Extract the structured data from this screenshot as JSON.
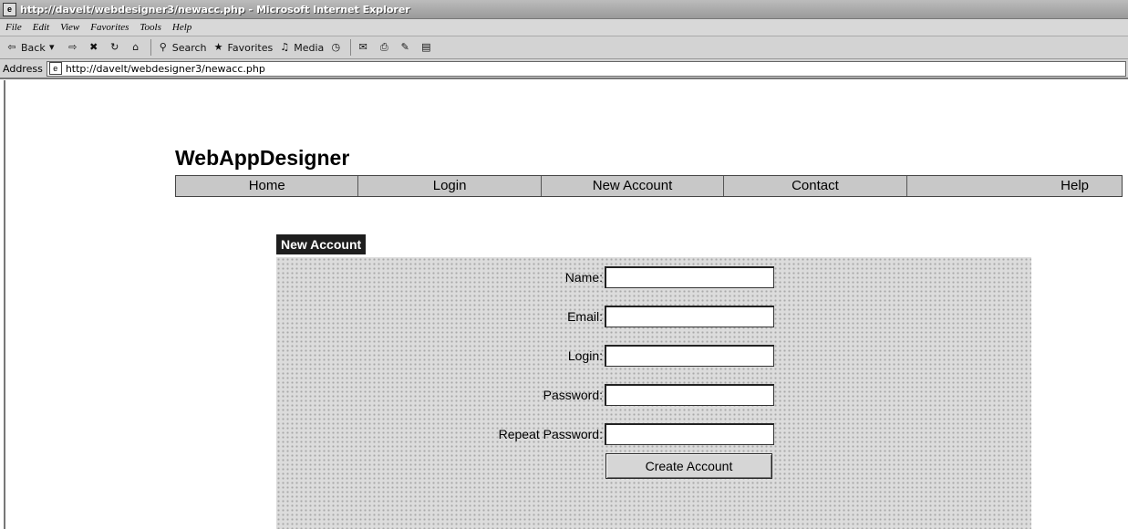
{
  "window": {
    "title": "http://davelt/webdesigner3/newacc.php - Microsoft Internet Explorer"
  },
  "menu": [
    "File",
    "Edit",
    "View",
    "Favorites",
    "Tools",
    "Help"
  ],
  "toolbar": {
    "back": "Back",
    "search": "Search",
    "favorites": "Favorites",
    "media": "Media"
  },
  "address": {
    "label": "Address",
    "url": "http://davelt/webdesigner3/newacc.php"
  },
  "site": {
    "title": "WebAppDesigner"
  },
  "nav": [
    "Home",
    "Login",
    "New Account",
    "Contact",
    "Help"
  ],
  "panel": {
    "header": "New Account",
    "fields": [
      {
        "label": "Name:",
        "value": ""
      },
      {
        "label": "Email:",
        "value": ""
      },
      {
        "label": "Login:",
        "value": ""
      },
      {
        "label": "Password:",
        "value": ""
      },
      {
        "label": "Repeat Password:",
        "value": ""
      }
    ],
    "submit": "Create Account"
  }
}
